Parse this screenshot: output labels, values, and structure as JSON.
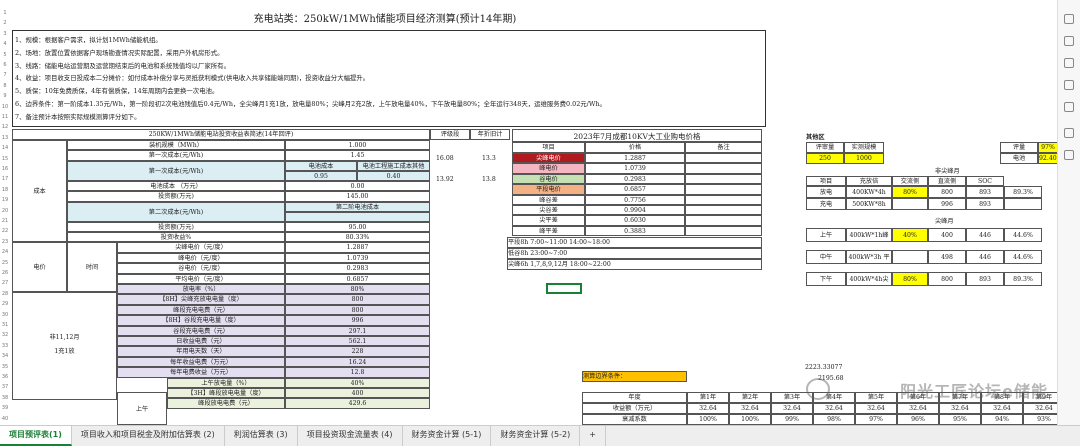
{
  "title": "充电站类：250kW/1MWh储能项目经济测算(预计14年期)",
  "notes": [
    "1、规模：根据客户需求，拟计划1MWh储能机组。",
    "2、场地：放置位置依据客户现场勘查情况实际配置，采用户外机房形式。",
    "3、线路：储能电站运营期及运营期结束后的电池和系统残值均以厂家所有。",
    "4、收益：项目收支日投成本二分摊价：如付成本补偿分享与灵抵获利模式(供电收入共享储能端同期)，投资收益分大幅提升。",
    "5、质保：10年免费质保，4年有偿质保，14年周期内会更换一次电池。",
    "6、边界条件：第一阶成本1.35元/Wh，第一阶段初2次电池残值后0.4元/Wh，全尖峰月1充1放，放电量80%；尖峰月2充2放，上午放电量40%，下午放电量80%；全年运行348天，运维服务费0.02元/Wh。",
    "7、备注预计本按照实际规模测算评分如下。"
  ],
  "left_table": {
    "header": "250KW/1MWh储能电站投资收益表简述(14年回评)",
    "rows": [
      {
        "label": "装机规模（MWh）",
        "value": "1.000"
      },
      {
        "label": "第一次成本(元/Wh)",
        "value": "1.45"
      },
      {
        "label": "第一次成本(元/Wh)",
        "sub1": "电池成本",
        "sub2": "电池工程施工成本其他",
        "v1": "0.95",
        "v2": "0.40"
      },
      {
        "label": "电池成本 （万元）",
        "value": "0.00"
      },
      {
        "label": "投资额(万元)",
        "value": "145.00"
      },
      {
        "label": "第二次成本(元/Wh)",
        "sub1": "第二阶电池成本"
      },
      {
        "label": "投资额(万元)",
        "value": "95.00"
      },
      {
        "label": "投资收益%",
        "value": "80.33%"
      },
      {
        "label": "尖峰电价（元/度）",
        "value": "1.2887"
      },
      {
        "label": "峰电价（元/度）",
        "value": "1.0739"
      },
      {
        "label": "谷电价（元/度）",
        "value": "0.2983"
      },
      {
        "label": "平均电价（元/度）",
        "value": "0.6857"
      },
      {
        "label": "放电率（%）",
        "value": "80%"
      },
      {
        "label": "【8H】尖峰充放电电量（度）",
        "value": "800"
      },
      {
        "label": "峰段充电电费（元）",
        "value": "800"
      },
      {
        "label": "【8H】谷段充电电量（度）",
        "value": "996"
      },
      {
        "label": "谷段充电电费（元）",
        "value": "297.1"
      },
      {
        "label": "日收益电费（元）",
        "value": "562.1"
      },
      {
        "label": "年用电天数（天）",
        "value": "228"
      },
      {
        "label": "每年收益电费（万元）",
        "value": "16.24"
      },
      {
        "label": "每年电费收益（万元）",
        "value": "12.8"
      },
      {
        "label": "上午放电量（%）",
        "value": "40%"
      },
      {
        "label": "【3H】峰段放电电量（度）",
        "value": "400"
      },
      {
        "label": "峰段放电电费（元）",
        "value": "429.6"
      }
    ],
    "group_cost": "成本",
    "group_price": "电价",
    "group_price_sub": "时间",
    "group_months": "非11,12月\n1充1放",
    "group_morning": "上午"
  },
  "mid_cols": {
    "h1": "评级段",
    "h2": "年折旧计",
    "r1a": "16.08",
    "r1b": "13.3",
    "r2a": "13.92",
    "r2b": "13.8"
  },
  "price_table": {
    "title": "2023年7月成都10KV大工业购电价格",
    "headers": [
      "项目",
      "价格",
      "备注"
    ],
    "rows": [
      {
        "label": "尖峰电价",
        "value": "1.2887"
      },
      {
        "label": "峰电价",
        "value": "1.0739"
      },
      {
        "label": "谷电价",
        "value": "0.2983"
      },
      {
        "label": "平段电价",
        "value": "0.6857"
      },
      {
        "label": "峰谷差",
        "value": "0.7756"
      },
      {
        "label": "尖谷差",
        "value": "0.9904"
      },
      {
        "label": "尖平差",
        "value": "0.6030"
      },
      {
        "label": "峰平差",
        "value": "0.3883"
      }
    ],
    "times": [
      "平段8h  7:00~11:00 14:00~18:00",
      "低谷8h  23:00~7:00",
      "尖峰6h  1,7,8,9,12月 18:00~22:00"
    ]
  },
  "right_panel": {
    "title": "其他区",
    "h1": "评审量",
    "h2": "实测规模",
    "h3": "评量",
    "h3v": "97%",
    "r1a": "250",
    "r1b": "1000",
    "h4": "电池",
    "h4v": "92.40%",
    "sec1": "非尖峰月",
    "cols": [
      "项目",
      "充放倍",
      "交流侧",
      "直流侧",
      "SOC"
    ],
    "rows1": [
      {
        "a": "放电",
        "b": "400KW*4h",
        "c": "80%",
        "d": "800",
        "e": "893",
        "f": "89.3%"
      },
      {
        "a": "充电",
        "b": "500KW*8h",
        "c": "",
        "d": "996",
        "e": "893",
        "f": ""
      }
    ],
    "sec2": "尖峰月",
    "rows2": [
      {
        "a": "上午",
        "b": "400kW*1h峰",
        "c": "40%",
        "d": "400",
        "e": "446",
        "f": "44.6%"
      },
      {
        "a": "中午",
        "b": "400kW*3h 平",
        "c": "",
        "d": "498",
        "e": "446",
        "f": "44.6%"
      },
      {
        "a": "下午",
        "b": "400kW*4h尖",
        "c": "80%",
        "d": "800",
        "e": "893",
        "f": "89.3%"
      }
    ]
  },
  "bottom": {
    "label": "测算边界条件：",
    "num1": "2223.33077",
    "num2": "2195.68",
    "headers": [
      "年度",
      "第1年",
      "第2年",
      "第3年",
      "第4年",
      "第5年",
      "第6年",
      "第7年",
      "第8年",
      "第9年"
    ],
    "row1_label": "收益额（万元）",
    "row1": [
      "32.64",
      "32.64",
      "32.64",
      "32.64",
      "32.64",
      "32.64",
      "32.64",
      "32.64",
      "32.64"
    ],
    "row2_label": "衰减系数",
    "row2": [
      "100%",
      "100%",
      "99%",
      "98%",
      "97%",
      "96%",
      "95%",
      "94%",
      "93%"
    ]
  },
  "tabs": [
    "项目预评表(1)",
    "项目收入和项目税金及附加估算表 (2)",
    "利润估算表 (3)",
    "项目投资现金流量表 (4)",
    "财务资金计算 (5-1)",
    "财务资金计算 (5-2)",
    "+"
  ],
  "watermark": "阳光工匠论坛e储能"
}
